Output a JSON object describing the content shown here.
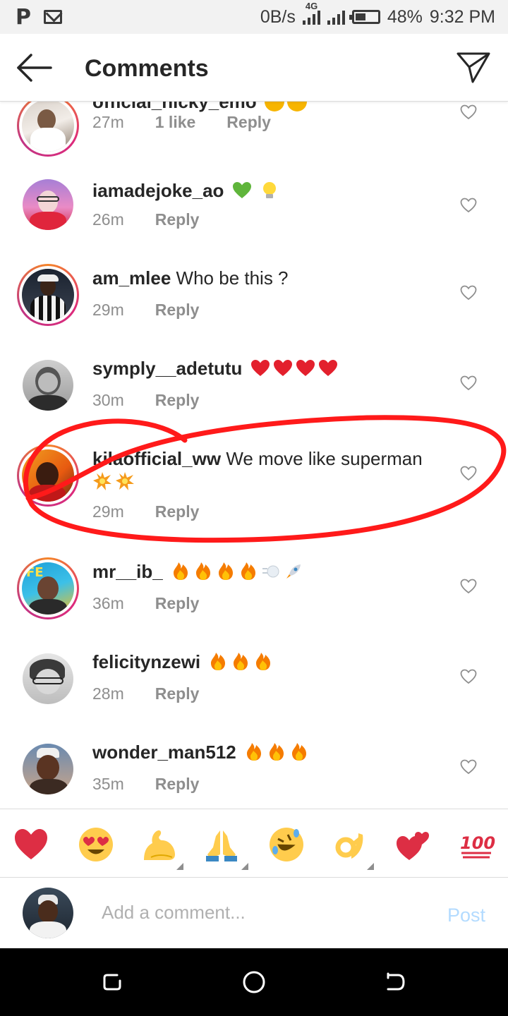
{
  "status_bar": {
    "speed": "0B/s",
    "network": "4G",
    "battery": "48%",
    "time": "9:32 PM",
    "battery_level": 0.48
  },
  "header": {
    "title": "Comments",
    "back_icon": "arrow-left-icon",
    "send_icon": "paper-plane-icon"
  },
  "comments": [
    {
      "username": "official_nicky_emo",
      "text": "",
      "time": "27m",
      "likes": "1 like",
      "reply": "Reply",
      "emojis": [
        "grin",
        "grin"
      ],
      "ring": "story"
    },
    {
      "username": "iamadejoke_ao",
      "text": "",
      "time": "26m",
      "likes": "",
      "reply": "Reply",
      "emojis": [
        "green-heart",
        "light-bulb"
      ],
      "ring": "plain"
    },
    {
      "username": "am_mlee",
      "text": "Who be this ?",
      "time": "29m",
      "likes": "",
      "reply": "Reply",
      "emojis": [],
      "ring": "story"
    },
    {
      "username": "symply__adetutu",
      "text": "",
      "time": "30m",
      "likes": "",
      "reply": "Reply",
      "emojis": [
        "red-heart",
        "red-heart",
        "red-heart",
        "red-heart"
      ],
      "ring": "plain"
    },
    {
      "username": "kilaofficial_ww",
      "text": "We move like superman",
      "time": "29m",
      "likes": "",
      "reply": "Reply",
      "emojis": [
        "collision",
        "collision"
      ],
      "ring": "story"
    },
    {
      "username": "mr__ib_",
      "text": "",
      "time": "36m",
      "likes": "",
      "reply": "Reply",
      "emojis": [
        "fire",
        "fire",
        "fire",
        "fire",
        "dash",
        "rocket"
      ],
      "ring": "story"
    },
    {
      "username": "felicitynzewi",
      "text": "",
      "time": "28m",
      "likes": "",
      "reply": "Reply",
      "emojis": [
        "fire",
        "fire",
        "fire"
      ],
      "ring": "plain"
    },
    {
      "username": "wonder_man512",
      "text": "",
      "time": "35m",
      "likes": "",
      "reply": "Reply",
      "emojis": [
        "fire",
        "fire",
        "fire"
      ],
      "ring": "plain"
    }
  ],
  "reactions": [
    "red-heart",
    "heart-eyes",
    "flexed-biceps",
    "folded-hands",
    "rofl",
    "ok-hand",
    "two-hearts",
    "hundred-points"
  ],
  "composer": {
    "placeholder": "Add a comment...",
    "post_label": "Post"
  },
  "nav_icons": [
    "recent-apps-icon",
    "home-icon",
    "back-icon"
  ],
  "colors": {
    "accent": "#0095f6",
    "post_disabled": "#b3dbff",
    "annotation": "#ff1a1a",
    "story_ring": "#e66b1f"
  }
}
